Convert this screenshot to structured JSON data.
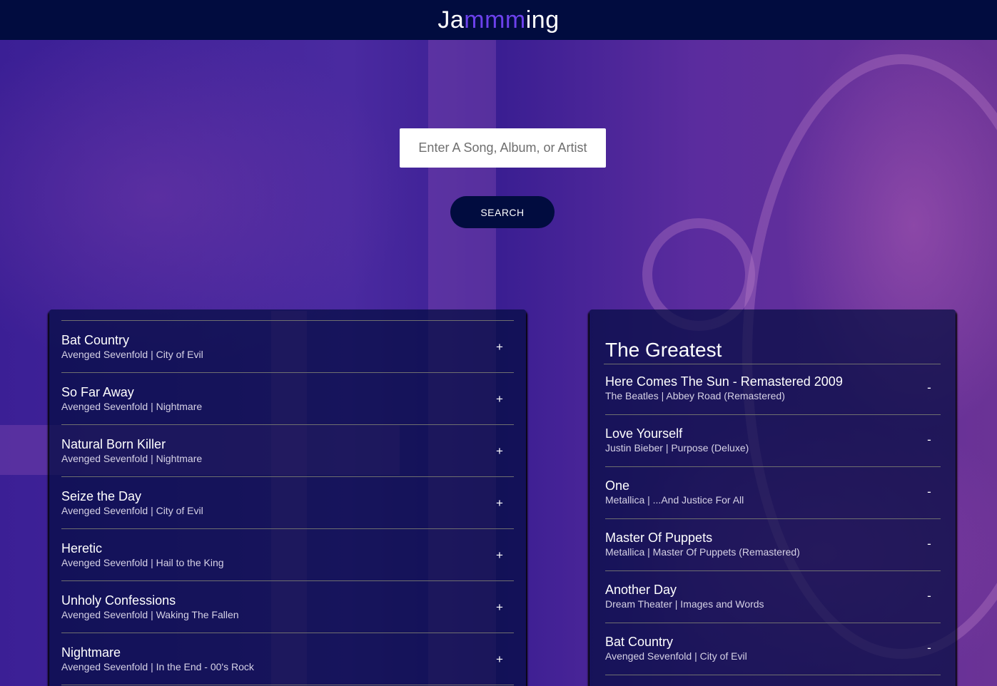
{
  "app": {
    "logo_part1": "Ja",
    "logo_accent": "mmm",
    "logo_part2": "ing",
    "accent_color": "#6c41ec",
    "header_color": "#010c3f"
  },
  "search": {
    "placeholder": "Enter A Song, Album, or Artist",
    "value": "",
    "button_label": "SEARCH"
  },
  "results": {
    "action_symbol": "+",
    "tracks": [
      {
        "name": "Bat Country",
        "meta": "Avenged Sevenfold | City of Evil"
      },
      {
        "name": "So Far Away",
        "meta": "Avenged Sevenfold | Nightmare"
      },
      {
        "name": "Natural Born Killer",
        "meta": "Avenged Sevenfold | Nightmare"
      },
      {
        "name": "Seize the Day",
        "meta": "Avenged Sevenfold | City of Evil"
      },
      {
        "name": "Heretic",
        "meta": "Avenged Sevenfold | Hail to the King"
      },
      {
        "name": "Unholy Confessions",
        "meta": "Avenged Sevenfold | Waking The Fallen"
      },
      {
        "name": "Nightmare",
        "meta": "Avenged Sevenfold | In the End - 00's Rock"
      }
    ]
  },
  "playlist": {
    "title": "The Greatest",
    "action_symbol": "-",
    "tracks": [
      {
        "name": "Here Comes The Sun - Remastered 2009",
        "meta": "The Beatles | Abbey Road (Remastered)"
      },
      {
        "name": "Love Yourself",
        "meta": "Justin Bieber | Purpose (Deluxe)"
      },
      {
        "name": "One",
        "meta": "Metallica | ...And Justice For All"
      },
      {
        "name": "Master Of Puppets",
        "meta": "Metallica | Master Of Puppets (Remastered)"
      },
      {
        "name": "Another Day",
        "meta": "Dream Theater | Images and Words"
      },
      {
        "name": "Bat Country",
        "meta": "Avenged Sevenfold | City of Evil"
      }
    ]
  }
}
